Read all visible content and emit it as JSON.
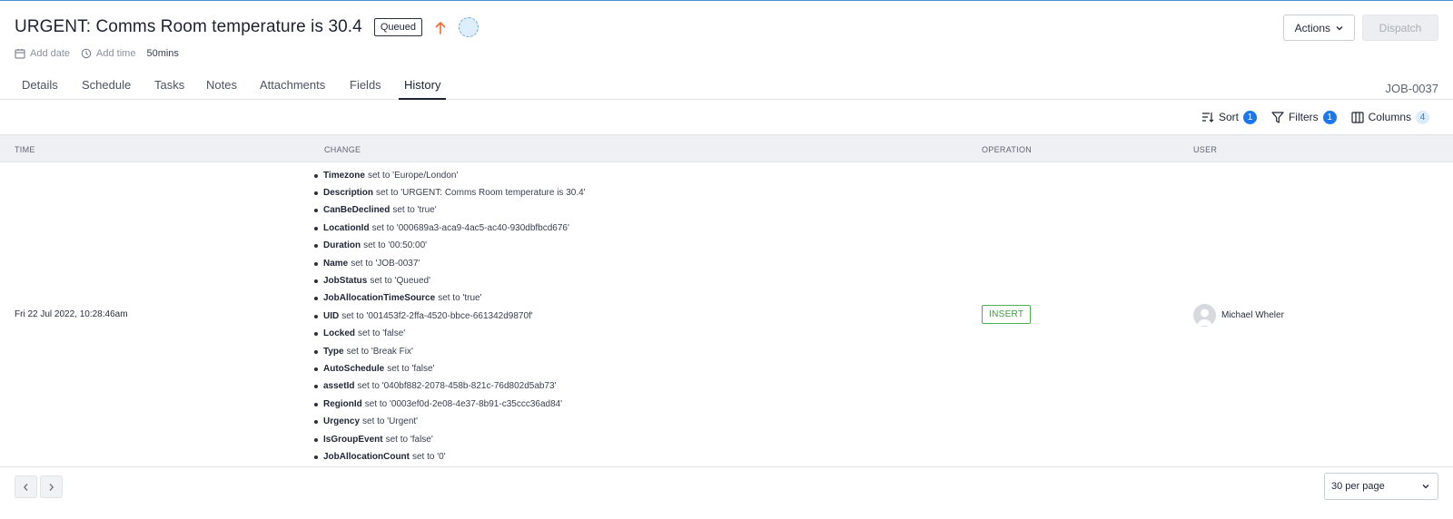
{
  "header": {
    "title": "URGENT: Comms Room temperature is 30.4",
    "status": "Queued",
    "add_date": "Add date",
    "add_time": "Add time",
    "duration": "50mins",
    "actions_label": "Actions",
    "dispatch_label": "Dispatch",
    "priority_color": "#f26b38"
  },
  "tabs": [
    {
      "label": "Details"
    },
    {
      "label": "Schedule"
    },
    {
      "label": "Tasks"
    },
    {
      "label": "Notes"
    },
    {
      "label": "Attachments"
    },
    {
      "label": "Fields"
    },
    {
      "label": "History",
      "active": true
    }
  ],
  "job_id": "JOB-0037",
  "toolbar": {
    "sort_label": "Sort",
    "sort_count": "1",
    "filters_label": "Filters",
    "filters_count": "1",
    "columns_label": "Columns",
    "columns_count": "4"
  },
  "table": {
    "columns": [
      "TIME",
      "CHANGE",
      "OPERATION",
      "USER"
    ],
    "row": {
      "time": "Fri 22 Jul 2022, 10:28:46am",
      "changes": [
        {
          "field": "Timezone",
          "text": "set to 'Europe/London'"
        },
        {
          "field": "Description",
          "text": "set to 'URGENT: Comms Room temperature is 30.4'"
        },
        {
          "field": "CanBeDeclined",
          "text": "set to 'true'"
        },
        {
          "field": "LocationId",
          "text": "set to '000689a3-aca9-4ac5-ac40-930dbfbcd676'"
        },
        {
          "field": "Duration",
          "text": "set to '00:50:00'"
        },
        {
          "field": "Name",
          "text": "set to 'JOB-0037'"
        },
        {
          "field": "JobStatus",
          "text": "set to 'Queued'"
        },
        {
          "field": "JobAllocationTimeSource",
          "text": "set to 'true'"
        },
        {
          "field": "UID",
          "text": "set to '001453f2-2ffa-4520-bbce-661342d9870f'"
        },
        {
          "field": "Locked",
          "text": "set to 'false'"
        },
        {
          "field": "Type",
          "text": "set to 'Break Fix'"
        },
        {
          "field": "AutoSchedule",
          "text": "set to 'false'"
        },
        {
          "field": "assetId",
          "text": "set to '040bf882-2078-458b-821c-76d802d5ab73'"
        },
        {
          "field": "RegionId",
          "text": "set to '0003ef0d-2e08-4e37-8b91-c35ccc36ad84'"
        },
        {
          "field": "Urgency",
          "text": "set to 'Urgent'"
        },
        {
          "field": "IsGroupEvent",
          "text": "set to 'false'"
        },
        {
          "field": "JobAllocationCount",
          "text": "set to '0'"
        }
      ],
      "operation": "INSERT",
      "user": "Michael Wheler"
    }
  },
  "footer": {
    "per_page": "30 per page"
  }
}
